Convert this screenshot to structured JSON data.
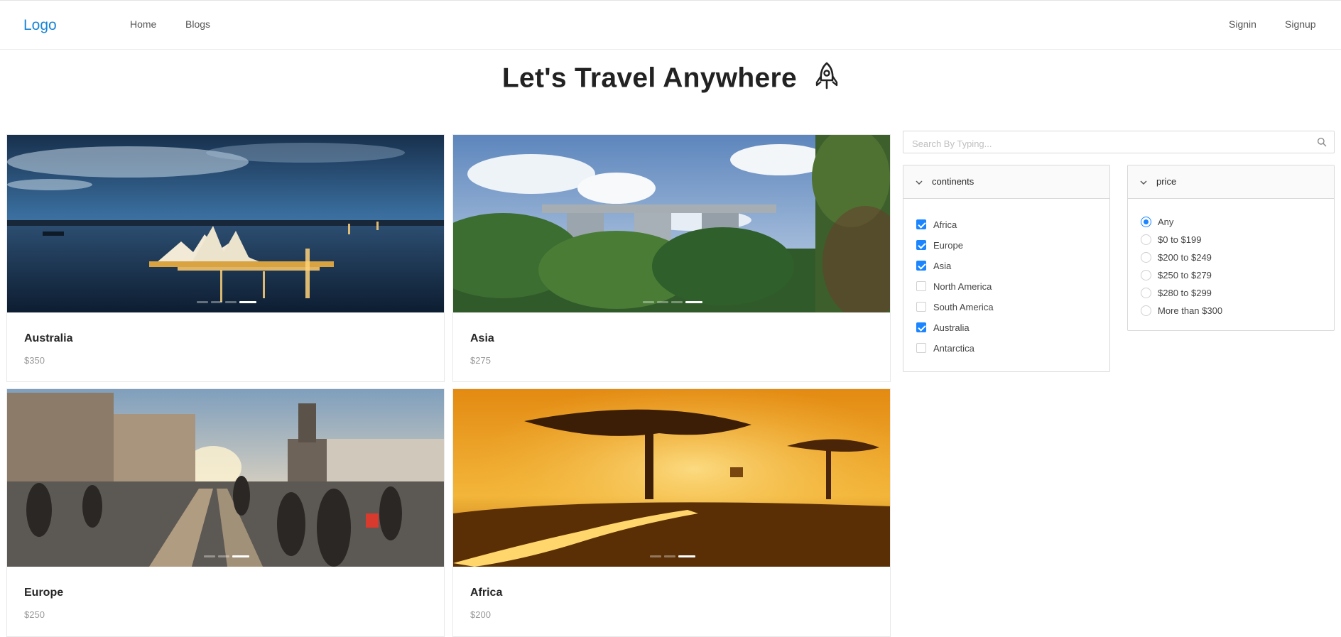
{
  "navbar": {
    "logo": "Logo",
    "links": [
      "Home",
      "Blogs"
    ],
    "auth": [
      "Signin",
      "Signup"
    ]
  },
  "page": {
    "title": "Let's Travel Anywhere",
    "title_icon": "rocket-icon"
  },
  "destinations": [
    {
      "name": "Australia",
      "price": "$350",
      "image": "sydney-opera-house-night"
    },
    {
      "name": "Asia",
      "price": "$275",
      "image": "marina-bay-sands-gardens"
    },
    {
      "name": "Europe",
      "price": "$250",
      "image": "old-town-square-sunset"
    },
    {
      "name": "Africa",
      "price": "$200",
      "image": "savanna-golden-sunrise"
    }
  ],
  "search": {
    "placeholder": "Search By Typing...",
    "icon": "search-icon"
  },
  "filters": {
    "continents": {
      "title": "continents",
      "options": [
        {
          "label": "Africa",
          "checked": true
        },
        {
          "label": "Europe",
          "checked": true
        },
        {
          "label": "Asia",
          "checked": true
        },
        {
          "label": "North America",
          "checked": false
        },
        {
          "label": "South America",
          "checked": false
        },
        {
          "label": "Australia",
          "checked": true
        },
        {
          "label": "Antarctica",
          "checked": false
        }
      ]
    },
    "price": {
      "title": "price",
      "options": [
        {
          "label": "Any",
          "selected": true
        },
        {
          "label": "$0 to $199",
          "selected": false
        },
        {
          "label": "$200 to $249",
          "selected": false
        },
        {
          "label": "$250 to $279",
          "selected": false
        },
        {
          "label": "$280 to $299",
          "selected": false
        },
        {
          "label": "More than $300",
          "selected": false
        }
      ]
    }
  },
  "colors": {
    "accent": "#1a85ff",
    "logo": "#1a85d6"
  }
}
